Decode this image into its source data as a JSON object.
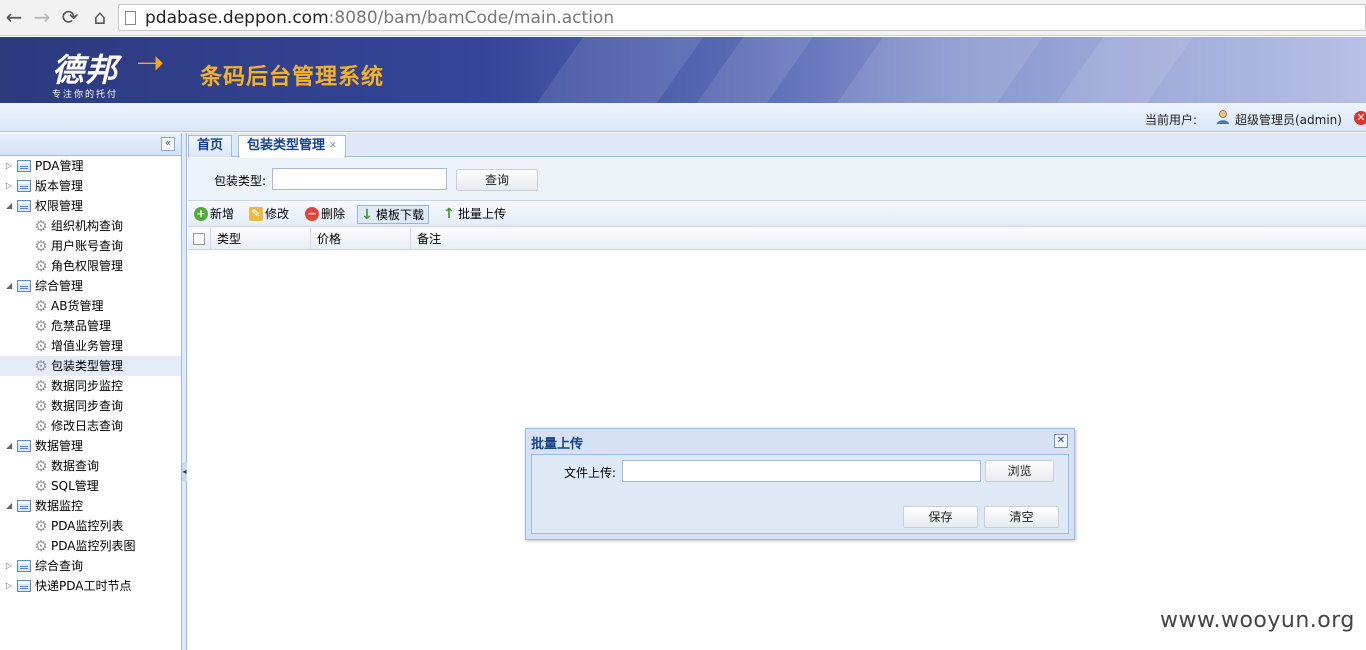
{
  "browser": {
    "back": "←",
    "forward": "→",
    "reload": "⟳",
    "home": "⌂",
    "url_host": "pdabase.deppon.com",
    "url_rest": ":8080/bam/bamCode/main.action"
  },
  "header": {
    "logo": "德邦",
    "slogan": "专注你的托付",
    "title": "条码后台管理系统"
  },
  "userbar": {
    "label": "当前用户:",
    "user": "超级管理员(admin)"
  },
  "sidebar": {
    "collapse": "«",
    "items": [
      {
        "label": "PDA管理",
        "level": 1,
        "expanded": false
      },
      {
        "label": "版本管理",
        "level": 1,
        "expanded": false
      },
      {
        "label": "权限管理",
        "level": 1,
        "expanded": true
      },
      {
        "label": "组织机构查询",
        "level": 2
      },
      {
        "label": "用户账号查询",
        "level": 2
      },
      {
        "label": "角色权限管理",
        "level": 2
      },
      {
        "label": "综合管理",
        "level": 1,
        "expanded": true
      },
      {
        "label": "AB货管理",
        "level": 2
      },
      {
        "label": "危禁品管理",
        "level": 2
      },
      {
        "label": "增值业务管理",
        "level": 2
      },
      {
        "label": "包装类型管理",
        "level": 2,
        "selected": true
      },
      {
        "label": "数据同步监控",
        "level": 2
      },
      {
        "label": "数据同步查询",
        "level": 2
      },
      {
        "label": "修改日志查询",
        "level": 2
      },
      {
        "label": "数据管理",
        "level": 1,
        "expanded": true
      },
      {
        "label": "数据查询",
        "level": 2
      },
      {
        "label": "SQL管理",
        "level": 2
      },
      {
        "label": "数据监控",
        "level": 1,
        "expanded": true
      },
      {
        "label": "PDA监控列表",
        "level": 2
      },
      {
        "label": "PDA监控列表图",
        "level": 2
      },
      {
        "label": "综合查询",
        "level": 1,
        "expanded": false
      },
      {
        "label": "快递PDA工时节点",
        "level": 1,
        "expanded": false
      }
    ]
  },
  "tabs": [
    {
      "label": "首页"
    },
    {
      "label": "包装类型管理",
      "active": true
    }
  ],
  "search": {
    "label": "包装类型:",
    "value": "",
    "button": "查询"
  },
  "toolbar": {
    "add": "新增",
    "edit": "修改",
    "delete": "删除",
    "template": "模板下载",
    "upload": "批量上传"
  },
  "grid": {
    "columns": [
      "类型",
      "价格",
      "备注"
    ]
  },
  "dialog": {
    "title": "批量上传",
    "file_label": "文件上传:",
    "file_value": "",
    "browse": "浏览",
    "save": "保存",
    "clear": "清空"
  },
  "watermark": "www.wooyun.org",
  "colors": {
    "banner": "#34459a",
    "title_gold": "#f6b225",
    "tab_text": "#15428b",
    "border_blue": "#99bbe8"
  }
}
